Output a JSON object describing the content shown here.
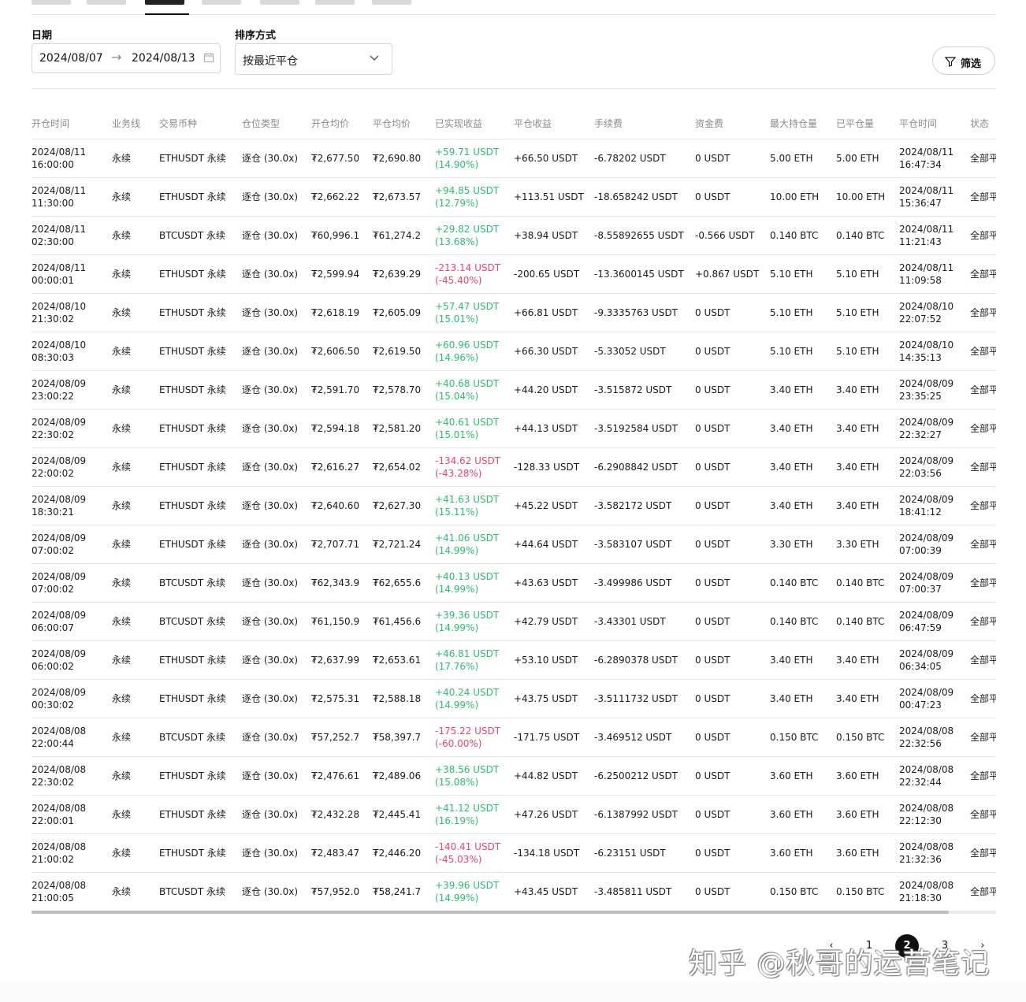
{
  "filters": {
    "date_label": "日期",
    "date_start": "2024/08/07",
    "date_end": "2024/08/13",
    "sort_label": "排序方式",
    "sort_value": "按最近平仓",
    "filter_button": "筛选"
  },
  "table": {
    "columns": [
      "开仓时间",
      "业务线",
      "交易币种",
      "仓位类型",
      "开仓均价",
      "平仓均价",
      "已实现收益",
      "平仓收益",
      "手续费",
      "资金费",
      "最大持仓量",
      "已平仓量",
      "平仓时间",
      "状态"
    ],
    "rows": [
      {
        "open_date": "2024/08/11",
        "open_time": "16:00:00",
        "line": "永续",
        "symbol": "ETHUSDT 永续",
        "margin": "逐仓 (30.0x)",
        "open_price": "₮2,677.50",
        "close_price": "₮2,690.80",
        "pnl": "+59.71 USDT",
        "pnl_pct": "(14.90%)",
        "sign": "pos",
        "close_pnl": "+66.50 USDT",
        "fee": "-6.78202 USDT",
        "funding": "0 USDT",
        "max_pos": "5.00 ETH",
        "closed_qty": "5.00 ETH",
        "close_date": "2024/08/11",
        "close_time": "16:47:34",
        "status": "全部平"
      },
      {
        "open_date": "2024/08/11",
        "open_time": "11:30:00",
        "line": "永续",
        "symbol": "ETHUSDT 永续",
        "margin": "逐仓 (30.0x)",
        "open_price": "₮2,662.22",
        "close_price": "₮2,673.57",
        "pnl": "+94.85 USDT",
        "pnl_pct": "(12.79%)",
        "sign": "pos",
        "close_pnl": "+113.51 USDT",
        "fee": "-18.658242 USDT",
        "funding": "0 USDT",
        "max_pos": "10.00 ETH",
        "closed_qty": "10.00 ETH",
        "close_date": "2024/08/11",
        "close_time": "15:36:47",
        "status": "全部平"
      },
      {
        "open_date": "2024/08/11",
        "open_time": "02:30:00",
        "line": "永续",
        "symbol": "BTCUSDT 永续",
        "margin": "逐仓 (30.0x)",
        "open_price": "₮60,996.1",
        "close_price": "₮61,274.2",
        "pnl": "+29.82 USDT",
        "pnl_pct": "(13.68%)",
        "sign": "pos",
        "close_pnl": "+38.94 USDT",
        "fee": "-8.55892655 USDT",
        "funding": "-0.566 USDT",
        "max_pos": "0.140 BTC",
        "closed_qty": "0.140 BTC",
        "close_date": "2024/08/11",
        "close_time": "11:21:43",
        "status": "全部平"
      },
      {
        "open_date": "2024/08/11",
        "open_time": "00:00:01",
        "line": "永续",
        "symbol": "ETHUSDT 永续",
        "margin": "逐仓 (30.0x)",
        "open_price": "₮2,599.94",
        "close_price": "₮2,639.29",
        "pnl": "-213.14 USDT",
        "pnl_pct": "(-45.40%)",
        "sign": "neg",
        "close_pnl": "-200.65 USDT",
        "fee": "-13.3600145 USDT",
        "funding": "+0.867 USDT",
        "max_pos": "5.10 ETH",
        "closed_qty": "5.10 ETH",
        "close_date": "2024/08/11",
        "close_time": "11:09:58",
        "status": "全部平"
      },
      {
        "open_date": "2024/08/10",
        "open_time": "21:30:02",
        "line": "永续",
        "symbol": "ETHUSDT 永续",
        "margin": "逐仓 (30.0x)",
        "open_price": "₮2,618.19",
        "close_price": "₮2,605.09",
        "pnl": "+57.47 USDT",
        "pnl_pct": "(15.01%)",
        "sign": "pos",
        "close_pnl": "+66.81 USDT",
        "fee": "-9.3335763 USDT",
        "funding": "0 USDT",
        "max_pos": "5.10 ETH",
        "closed_qty": "5.10 ETH",
        "close_date": "2024/08/10",
        "close_time": "22:07:52",
        "status": "全部平"
      },
      {
        "open_date": "2024/08/10",
        "open_time": "08:30:03",
        "line": "永续",
        "symbol": "ETHUSDT 永续",
        "margin": "逐仓 (30.0x)",
        "open_price": "₮2,606.50",
        "close_price": "₮2,619.50",
        "pnl": "+60.96 USDT",
        "pnl_pct": "(14.96%)",
        "sign": "pos",
        "close_pnl": "+66.30 USDT",
        "fee": "-5.33052 USDT",
        "funding": "0 USDT",
        "max_pos": "5.10 ETH",
        "closed_qty": "5.10 ETH",
        "close_date": "2024/08/10",
        "close_time": "14:35:13",
        "status": "全部平"
      },
      {
        "open_date": "2024/08/09",
        "open_time": "23:00:22",
        "line": "永续",
        "symbol": "ETHUSDT 永续",
        "margin": "逐仓 (30.0x)",
        "open_price": "₮2,591.70",
        "close_price": "₮2,578.70",
        "pnl": "+40.68 USDT",
        "pnl_pct": "(15.04%)",
        "sign": "pos",
        "close_pnl": "+44.20 USDT",
        "fee": "-3.515872 USDT",
        "funding": "0 USDT",
        "max_pos": "3.40 ETH",
        "closed_qty": "3.40 ETH",
        "close_date": "2024/08/09",
        "close_time": "23:35:25",
        "status": "全部平"
      },
      {
        "open_date": "2024/08/09",
        "open_time": "22:30:02",
        "line": "永续",
        "symbol": "ETHUSDT 永续",
        "margin": "逐仓 (30.0x)",
        "open_price": "₮2,594.18",
        "close_price": "₮2,581.20",
        "pnl": "+40.61 USDT",
        "pnl_pct": "(15.01%)",
        "sign": "pos",
        "close_pnl": "+44.13 USDT",
        "fee": "-3.5192584 USDT",
        "funding": "0 USDT",
        "max_pos": "3.40 ETH",
        "closed_qty": "3.40 ETH",
        "close_date": "2024/08/09",
        "close_time": "22:32:27",
        "status": "全部平"
      },
      {
        "open_date": "2024/08/09",
        "open_time": "22:00:02",
        "line": "永续",
        "symbol": "ETHUSDT 永续",
        "margin": "逐仓 (30.0x)",
        "open_price": "₮2,616.27",
        "close_price": "₮2,654.02",
        "pnl": "-134.62 USDT",
        "pnl_pct": "(-43.28%)",
        "sign": "neg",
        "close_pnl": "-128.33 USDT",
        "fee": "-6.2908842 USDT",
        "funding": "0 USDT",
        "max_pos": "3.40 ETH",
        "closed_qty": "3.40 ETH",
        "close_date": "2024/08/09",
        "close_time": "22:03:56",
        "status": "全部平"
      },
      {
        "open_date": "2024/08/09",
        "open_time": "18:30:21",
        "line": "永续",
        "symbol": "ETHUSDT 永续",
        "margin": "逐仓 (30.0x)",
        "open_price": "₮2,640.60",
        "close_price": "₮2,627.30",
        "pnl": "+41.63 USDT",
        "pnl_pct": "(15.11%)",
        "sign": "pos",
        "close_pnl": "+45.22 USDT",
        "fee": "-3.582172 USDT",
        "funding": "0 USDT",
        "max_pos": "3.40 ETH",
        "closed_qty": "3.40 ETH",
        "close_date": "2024/08/09",
        "close_time": "18:41:12",
        "status": "全部平"
      },
      {
        "open_date": "2024/08/09",
        "open_time": "07:00:02",
        "line": "永续",
        "symbol": "ETHUSDT 永续",
        "margin": "逐仓 (30.0x)",
        "open_price": "₮2,707.71",
        "close_price": "₮2,721.24",
        "pnl": "+41.06 USDT",
        "pnl_pct": "(14.99%)",
        "sign": "pos",
        "close_pnl": "+44.64 USDT",
        "fee": "-3.583107 USDT",
        "funding": "0 USDT",
        "max_pos": "3.30 ETH",
        "closed_qty": "3.30 ETH",
        "close_date": "2024/08/09",
        "close_time": "07:00:39",
        "status": "全部平"
      },
      {
        "open_date": "2024/08/09",
        "open_time": "07:00:02",
        "line": "永续",
        "symbol": "BTCUSDT 永续",
        "margin": "逐仓 (30.0x)",
        "open_price": "₮62,343.9",
        "close_price": "₮62,655.6",
        "pnl": "+40.13 USDT",
        "pnl_pct": "(14.99%)",
        "sign": "pos",
        "close_pnl": "+43.63 USDT",
        "fee": "-3.499986 USDT",
        "funding": "0 USDT",
        "max_pos": "0.140 BTC",
        "closed_qty": "0.140 BTC",
        "close_date": "2024/08/09",
        "close_time": "07:00:37",
        "status": "全部平"
      },
      {
        "open_date": "2024/08/09",
        "open_time": "06:00:07",
        "line": "永续",
        "symbol": "BTCUSDT 永续",
        "margin": "逐仓 (30.0x)",
        "open_price": "₮61,150.9",
        "close_price": "₮61,456.6",
        "pnl": "+39.36 USDT",
        "pnl_pct": "(14.99%)",
        "sign": "pos",
        "close_pnl": "+42.79 USDT",
        "fee": "-3.43301 USDT",
        "funding": "0 USDT",
        "max_pos": "0.140 BTC",
        "closed_qty": "0.140 BTC",
        "close_date": "2024/08/09",
        "close_time": "06:47:59",
        "status": "全部平"
      },
      {
        "open_date": "2024/08/09",
        "open_time": "06:00:02",
        "line": "永续",
        "symbol": "ETHUSDT 永续",
        "margin": "逐仓 (30.0x)",
        "open_price": "₮2,637.99",
        "close_price": "₮2,653.61",
        "pnl": "+46.81 USDT",
        "pnl_pct": "(17.76%)",
        "sign": "pos",
        "close_pnl": "+53.10 USDT",
        "fee": "-6.2890378 USDT",
        "funding": "0 USDT",
        "max_pos": "3.40 ETH",
        "closed_qty": "3.40 ETH",
        "close_date": "2024/08/09",
        "close_time": "06:34:05",
        "status": "全部平"
      },
      {
        "open_date": "2024/08/09",
        "open_time": "00:30:02",
        "line": "永续",
        "symbol": "ETHUSDT 永续",
        "margin": "逐仓 (30.0x)",
        "open_price": "₮2,575.31",
        "close_price": "₮2,588.18",
        "pnl": "+40.24 USDT",
        "pnl_pct": "(14.99%)",
        "sign": "pos",
        "close_pnl": "+43.75 USDT",
        "fee": "-3.5111732 USDT",
        "funding": "0 USDT",
        "max_pos": "3.40 ETH",
        "closed_qty": "3.40 ETH",
        "close_date": "2024/08/09",
        "close_time": "00:47:23",
        "status": "全部平"
      },
      {
        "open_date": "2024/08/08",
        "open_time": "22:00:44",
        "line": "永续",
        "symbol": "BTCUSDT 永续",
        "margin": "逐仓 (30.0x)",
        "open_price": "₮57,252.7",
        "close_price": "₮58,397.7",
        "pnl": "-175.22 USDT",
        "pnl_pct": "(-60.00%)",
        "sign": "neg",
        "close_pnl": "-171.75 USDT",
        "fee": "-3.469512 USDT",
        "funding": "0 USDT",
        "max_pos": "0.150 BTC",
        "closed_qty": "0.150 BTC",
        "close_date": "2024/08/08",
        "close_time": "22:32:56",
        "status": "全部平"
      },
      {
        "open_date": "2024/08/08",
        "open_time": "22:30:02",
        "line": "永续",
        "symbol": "ETHUSDT 永续",
        "margin": "逐仓 (30.0x)",
        "open_price": "₮2,476.61",
        "close_price": "₮2,489.06",
        "pnl": "+38.56 USDT",
        "pnl_pct": "(15.08%)",
        "sign": "pos",
        "close_pnl": "+44.82 USDT",
        "fee": "-6.2500212 USDT",
        "funding": "0 USDT",
        "max_pos": "3.60 ETH",
        "closed_qty": "3.60 ETH",
        "close_date": "2024/08/08",
        "close_time": "22:32:44",
        "status": "全部平"
      },
      {
        "open_date": "2024/08/08",
        "open_time": "22:00:01",
        "line": "永续",
        "symbol": "ETHUSDT 永续",
        "margin": "逐仓 (30.0x)",
        "open_price": "₮2,432.28",
        "close_price": "₮2,445.41",
        "pnl": "+41.12 USDT",
        "pnl_pct": "(16.19%)",
        "sign": "pos",
        "close_pnl": "+47.26 USDT",
        "fee": "-6.1387992 USDT",
        "funding": "0 USDT",
        "max_pos": "3.60 ETH",
        "closed_qty": "3.60 ETH",
        "close_date": "2024/08/08",
        "close_time": "22:12:30",
        "status": "全部平"
      },
      {
        "open_date": "2024/08/08",
        "open_time": "21:00:02",
        "line": "永续",
        "symbol": "ETHUSDT 永续",
        "margin": "逐仓 (30.0x)",
        "open_price": "₮2,483.47",
        "close_price": "₮2,446.20",
        "pnl": "-140.41 USDT",
        "pnl_pct": "(-45.03%)",
        "sign": "neg",
        "close_pnl": "-134.18 USDT",
        "fee": "-6.23151 USDT",
        "funding": "0 USDT",
        "max_pos": "3.60 ETH",
        "closed_qty": "3.60 ETH",
        "close_date": "2024/08/08",
        "close_time": "21:32:36",
        "status": "全部平"
      },
      {
        "open_date": "2024/08/08",
        "open_time": "21:00:05",
        "line": "永续",
        "symbol": "BTCUSDT 永续",
        "margin": "逐仓 (30.0x)",
        "open_price": "₮57,952.0",
        "close_price": "₮58,241.7",
        "pnl": "+39.96 USDT",
        "pnl_pct": "(14.99%)",
        "sign": "pos",
        "close_pnl": "+43.45 USDT",
        "fee": "-3.485811 USDT",
        "funding": "0 USDT",
        "max_pos": "0.150 BTC",
        "closed_qty": "0.150 BTC",
        "close_date": "2024/08/08",
        "close_time": "21:18:30",
        "status": "全部平"
      }
    ]
  },
  "pagination": {
    "prev_icon": "‹",
    "pages": [
      "1",
      "2",
      "3"
    ],
    "current": "2",
    "next_icon": "›"
  },
  "watermark": "知乎 @秋哥的运营笔记",
  "colors": {
    "positive": "#2dbd6e",
    "negative": "#e8466a",
    "accent": "#111111"
  }
}
